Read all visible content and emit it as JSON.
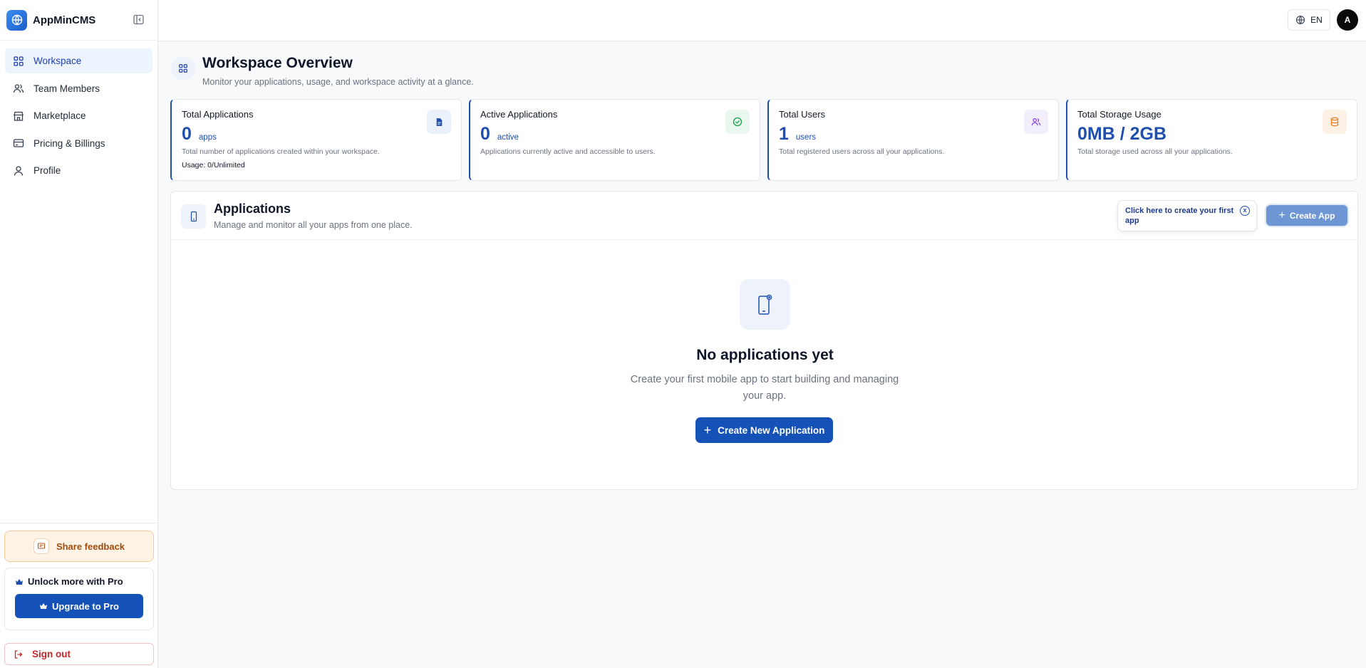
{
  "brand": {
    "name": "AppMinCMS"
  },
  "sidebar": {
    "items": [
      {
        "label": "Workspace",
        "icon": "grid-icon",
        "active": true
      },
      {
        "label": "Team Members",
        "icon": "users-icon",
        "active": false
      },
      {
        "label": "Marketplace",
        "icon": "store-icon",
        "active": false
      },
      {
        "label": "Pricing & Billings",
        "icon": "credit-card-icon",
        "active": false
      },
      {
        "label": "Profile",
        "icon": "user-icon",
        "active": false
      }
    ],
    "feedback_label": "Share feedback",
    "pro": {
      "title": "Unlock more with Pro",
      "button": "Upgrade to Pro"
    },
    "signout_label": "Sign out"
  },
  "topbar": {
    "language": "EN",
    "avatar_initial": "A"
  },
  "header": {
    "title": "Workspace Overview",
    "subtitle": "Monitor your applications, usage, and workspace activity at a glance."
  },
  "stats": [
    {
      "title": "Total Applications",
      "value": "0",
      "unit": "apps",
      "desc": "Total number of applications created within your workspace.",
      "usage": "Usage: 0/Unlimited",
      "icon": "document-icon",
      "icon_color": "#1e4fae",
      "icon_bg": "#eaf1fb"
    },
    {
      "title": "Active Applications",
      "value": "0",
      "unit": "active",
      "desc": "Applications currently active and accessible to users.",
      "icon": "check-circle-icon",
      "icon_color": "#16a34a",
      "icon_bg": "#eaf7ee"
    },
    {
      "title": "Total Users",
      "value": "1",
      "unit": "users",
      "desc": "Total registered users across all your applications.",
      "icon": "users-icon",
      "icon_color": "#7c3aed",
      "icon_bg": "#f3eefc"
    },
    {
      "title": "Total Storage Usage",
      "value": "0MB / 2GB",
      "unit": "",
      "desc": "Total storage used across all your applications.",
      "icon": "database-icon",
      "icon_color": "#ea7a1b",
      "icon_bg": "#fdf1e6"
    }
  ],
  "applications": {
    "title": "Applications",
    "subtitle": "Manage and monitor all your apps from one place.",
    "tooltip": "Click here to create your first app",
    "tooltip_close": "x",
    "create_button": "Create App",
    "empty": {
      "title": "No applications yet",
      "desc": "Create your first mobile app to start building and managing your app.",
      "button": "Create New Application"
    }
  }
}
